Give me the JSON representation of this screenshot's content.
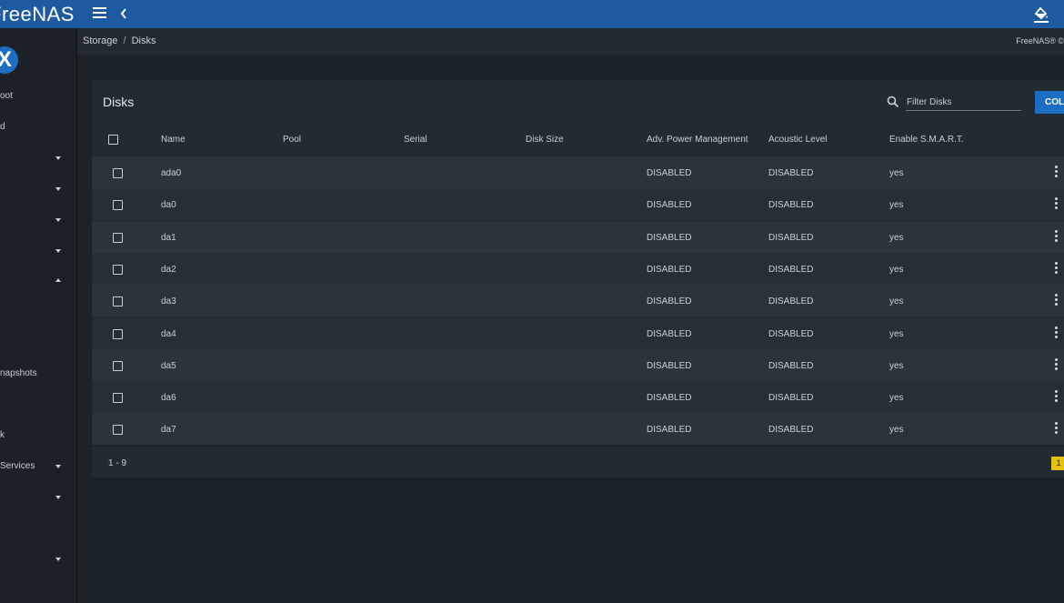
{
  "app": {
    "brand": "FreeNAS",
    "logo_letter": "X"
  },
  "topbar": {
    "menu_icon": "hamburger-icon",
    "back_icon": "chevron-left-icon",
    "theme_icon": "paint-bucket-icon"
  },
  "sidebar": {
    "items": [
      {
        "label": "oot"
      },
      {
        "label": "d"
      },
      {
        "label": ""
      },
      {
        "label": ""
      },
      {
        "label": ""
      },
      {
        "label": ""
      },
      {
        "label": ""
      },
      {
        "label": "napshots"
      },
      {
        "label": "k"
      },
      {
        "label": "Services"
      },
      {
        "label": ""
      },
      {
        "label": ""
      }
    ]
  },
  "breadcrumb": {
    "parent": "Storage",
    "separator": "/",
    "current": "Disks"
  },
  "copyright": "FreeNAS® ©",
  "card": {
    "title": "Disks",
    "filter_placeholder": "Filter Disks",
    "columns_button": "COL",
    "headers": [
      "Name",
      "Pool",
      "Serial",
      "Disk Size",
      "Adv. Power Management",
      "Acoustic Level",
      "Enable S.M.A.R.T."
    ],
    "rows": [
      {
        "name": "ada0",
        "pool": "",
        "serial": "",
        "size": "",
        "apm": "DISABLED",
        "acoustic": "DISABLED",
        "smart": "yes"
      },
      {
        "name": "da0",
        "pool": "",
        "serial": "",
        "size": "",
        "apm": "DISABLED",
        "acoustic": "DISABLED",
        "smart": "yes"
      },
      {
        "name": "da1",
        "pool": "",
        "serial": "",
        "size": "",
        "apm": "DISABLED",
        "acoustic": "DISABLED",
        "smart": "yes"
      },
      {
        "name": "da2",
        "pool": "",
        "serial": "",
        "size": "",
        "apm": "DISABLED",
        "acoustic": "DISABLED",
        "smart": "yes"
      },
      {
        "name": "da3",
        "pool": "",
        "serial": "",
        "size": "",
        "apm": "DISABLED",
        "acoustic": "DISABLED",
        "smart": "yes"
      },
      {
        "name": "da4",
        "pool": "",
        "serial": "",
        "size": "",
        "apm": "DISABLED",
        "acoustic": "DISABLED",
        "smart": "yes"
      },
      {
        "name": "da5",
        "pool": "",
        "serial": "",
        "size": "",
        "apm": "DISABLED",
        "acoustic": "DISABLED",
        "smart": "yes"
      },
      {
        "name": "da6",
        "pool": "",
        "serial": "",
        "size": "",
        "apm": "DISABLED",
        "acoustic": "DISABLED",
        "smart": "yes"
      },
      {
        "name": "da7",
        "pool": "",
        "serial": "",
        "size": "",
        "apm": "DISABLED",
        "acoustic": "DISABLED",
        "smart": "yes"
      }
    ],
    "range": "1 - 9",
    "page": "1"
  },
  "colors": {
    "topbar": "#1e5aa0",
    "accent": "#1b6ec2",
    "page_badge": "#e6c20f",
    "background": "#1c2329"
  }
}
